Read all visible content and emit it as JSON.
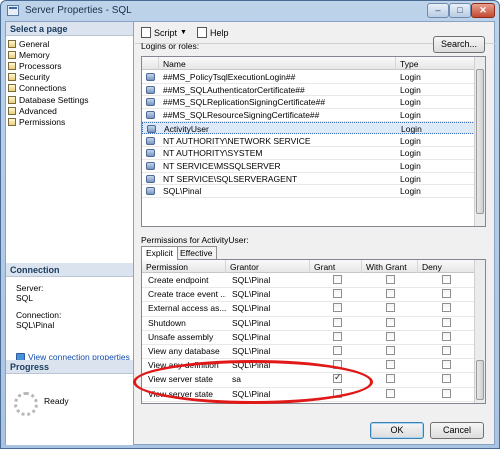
{
  "window": {
    "title": "Server Properties - SQL"
  },
  "left": {
    "select_page_header": "Select a page",
    "pages": [
      {
        "label": "General"
      },
      {
        "label": "Memory"
      },
      {
        "label": "Processors"
      },
      {
        "label": "Security"
      },
      {
        "label": "Connections"
      },
      {
        "label": "Database Settings"
      },
      {
        "label": "Advanced"
      },
      {
        "label": "Permissions"
      }
    ],
    "connection_header": "Connection",
    "server_label": "Server:",
    "server_value": "SQL",
    "connection_label": "Connection:",
    "connection_value": "SQL\\Pinal",
    "view_connection_link": "View connection properties",
    "progress_header": "Progress",
    "progress_status": "Ready"
  },
  "toolbar": {
    "script_label": "Script",
    "help_label": "Help"
  },
  "logins": {
    "label": "Logins or roles:",
    "search_button": "Search...",
    "columns": [
      "Name",
      "Type"
    ],
    "rows": [
      {
        "name": "##MS_PolicyTsqlExecutionLogin##",
        "type": "Login"
      },
      {
        "name": "##MS_SQLAuthenticatorCertificate##",
        "type": "Login"
      },
      {
        "name": "##MS_SQLReplicationSigningCertificate##",
        "type": "Login"
      },
      {
        "name": "##MS_SQLResourceSigningCertificate##",
        "type": "Login"
      },
      {
        "name": "ActivityUser",
        "type": "Login"
      },
      {
        "name": "NT AUTHORITY\\NETWORK SERVICE",
        "type": "Login"
      },
      {
        "name": "NT AUTHORITY\\SYSTEM",
        "type": "Login"
      },
      {
        "name": "NT SERVICE\\MSSQLSERVER",
        "type": "Login"
      },
      {
        "name": "NT SERVICE\\SQLSERVERAGENT",
        "type": "Login"
      },
      {
        "name": "SQL\\Pinal",
        "type": "Login"
      }
    ]
  },
  "permissions": {
    "label": "Permissions for ActivityUser:",
    "tabs": [
      "Explicit",
      "Effective"
    ],
    "columns": [
      "Permission",
      "Grantor",
      "Grant",
      "With Grant",
      "Deny"
    ],
    "rows": [
      {
        "permission": "Create endpoint",
        "grantor": "SQL\\Pinal",
        "grant": false,
        "with_grant": false,
        "deny": false
      },
      {
        "permission": "Create trace event ...",
        "grantor": "SQL\\Pinal",
        "grant": false,
        "with_grant": false,
        "deny": false
      },
      {
        "permission": "External access as...",
        "grantor": "SQL\\Pinal",
        "grant": false,
        "with_grant": false,
        "deny": false
      },
      {
        "permission": "Shutdown",
        "grantor": "SQL\\Pinal",
        "grant": false,
        "with_grant": false,
        "deny": false
      },
      {
        "permission": "Unsafe assembly",
        "grantor": "SQL\\Pinal",
        "grant": false,
        "with_grant": false,
        "deny": false
      },
      {
        "permission": "View any database",
        "grantor": "SQL\\Pinal",
        "grant": false,
        "with_grant": false,
        "deny": false
      },
      {
        "permission": "View any definition",
        "grantor": "SQL\\Pinal",
        "grant": false,
        "with_grant": false,
        "deny": false
      },
      {
        "permission": "View server state",
        "grantor": "sa",
        "grant": true,
        "with_grant": false,
        "deny": false
      },
      {
        "permission": "View server state",
        "grantor": "SQL\\Pinal",
        "grant": false,
        "with_grant": false,
        "deny": false
      }
    ]
  },
  "buttons": {
    "ok": "OK",
    "cancel": "Cancel"
  },
  "colors": {
    "highlight": "#e01818",
    "selection": "#dfeaf8",
    "link": "#0d4ab0"
  },
  "icons": {
    "page": "page-icon",
    "login": "user-icon",
    "script": "script-icon",
    "help": "help-icon",
    "link": "connection-icon"
  }
}
